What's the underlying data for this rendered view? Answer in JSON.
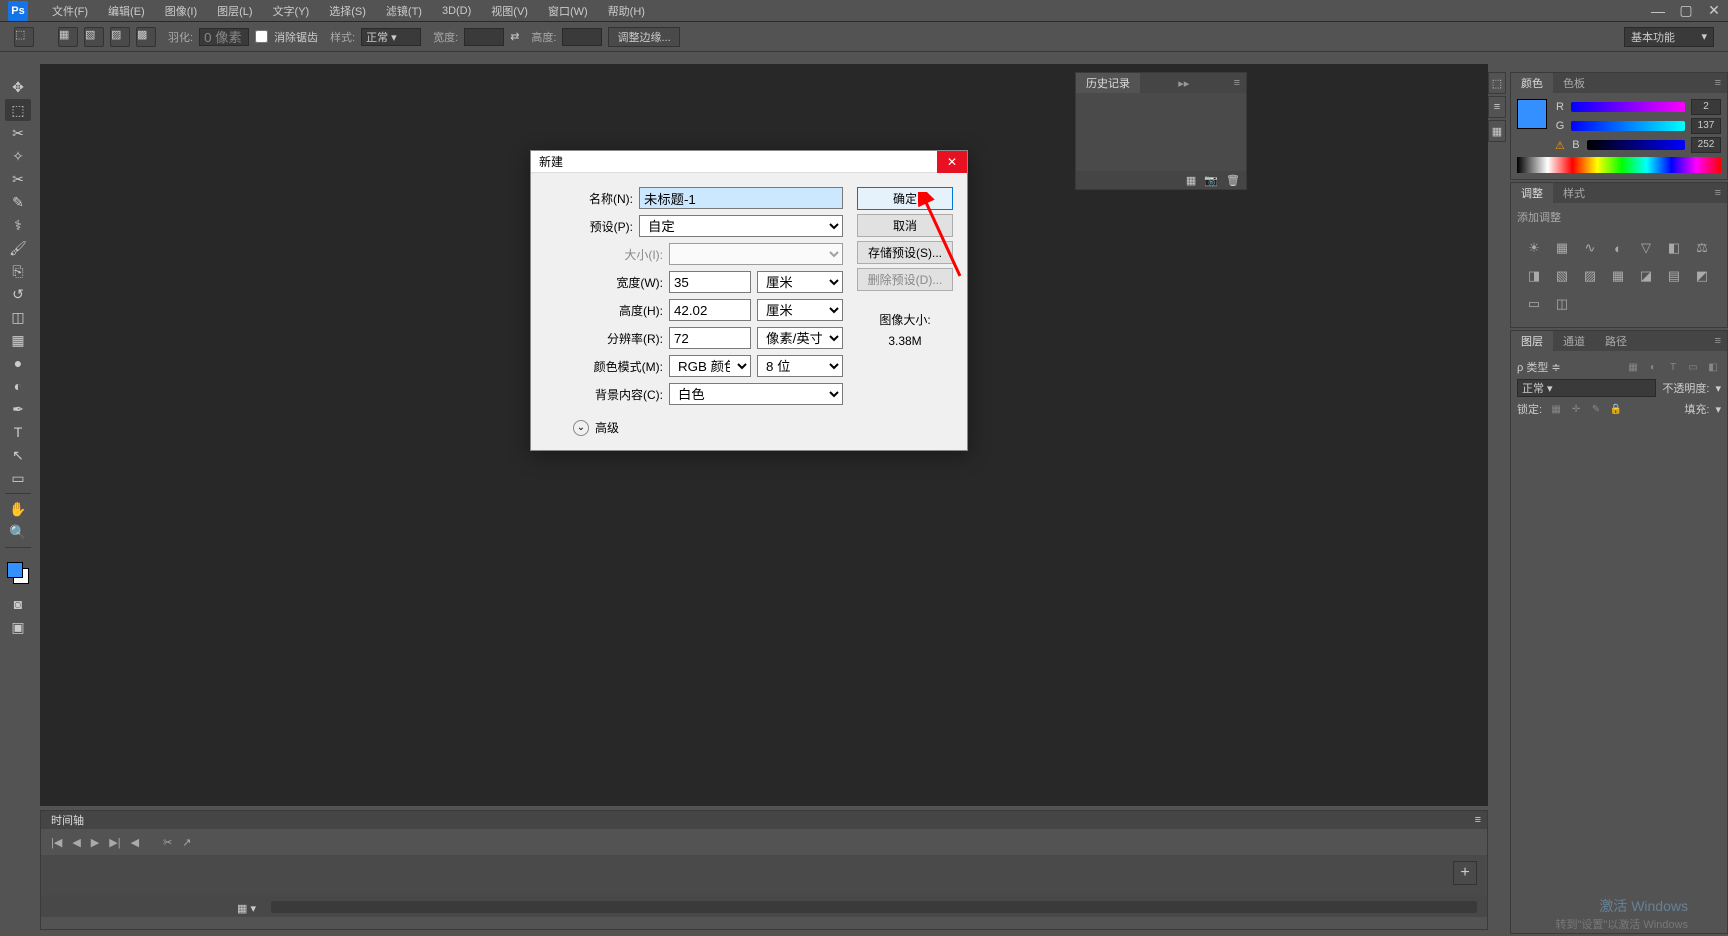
{
  "menubar": {
    "items": [
      "文件(F)",
      "编辑(E)",
      "图像(I)",
      "图层(L)",
      "文字(Y)",
      "选择(S)",
      "滤镜(T)",
      "3D(D)",
      "视图(V)",
      "窗口(W)",
      "帮助(H)"
    ]
  },
  "optionsbar": {
    "feather_label": "羽化:",
    "feather_value": "0 像素",
    "antialias": "消除锯齿",
    "style_label": "样式:",
    "style_value": "正常",
    "width_label": "宽度:",
    "height_label": "高度:",
    "refine_edge": "调整边缘...",
    "workspace": "基本功能"
  },
  "history": {
    "title": "历史记录"
  },
  "timeline": {
    "title": "时间轴"
  },
  "colorPanel": {
    "tabs": [
      "颜色",
      "色板"
    ],
    "channels": [
      {
        "label": "R",
        "value": "2"
      },
      {
        "label": "G",
        "value": "137"
      },
      {
        "label": "B",
        "value": "252"
      }
    ]
  },
  "adjustPanel": {
    "tabs": [
      "调整",
      "样式"
    ],
    "subtitle": "添加调整"
  },
  "layersPanel": {
    "tabs": [
      "图层",
      "通道",
      "路径"
    ],
    "filter_label": "类型",
    "blend_mode": "正常",
    "opacity_label": "不透明度:",
    "lock_label": "锁定:",
    "fill_label": "填充:"
  },
  "dialog": {
    "title": "新建",
    "name_label": "名称(N):",
    "name_value": "未标题-1",
    "preset_label": "预设(P):",
    "preset_value": "自定",
    "size_label": "大小(I):",
    "width_label": "宽度(W):",
    "width_value": "35",
    "width_unit": "厘米",
    "height_label": "高度(H):",
    "height_value": "42.02",
    "height_unit": "厘米",
    "res_label": "分辨率(R):",
    "res_value": "72",
    "res_unit": "像素/英寸",
    "colormode_label": "颜色模式(M):",
    "colormode_value": "RGB 颜色",
    "colordepth_value": "8 位",
    "bgcontent_label": "背景内容(C):",
    "bgcontent_value": "白色",
    "advanced_label": "高级",
    "ok": "确定",
    "cancel": "取消",
    "save_preset": "存储预设(S)...",
    "delete_preset": "删除预设(D)...",
    "imagesize_label": "图像大小:",
    "imagesize_value": "3.38M"
  },
  "watermark": {
    "line1": "激活 Windows",
    "line2": "转到\"设置\"以激活 Windows"
  }
}
